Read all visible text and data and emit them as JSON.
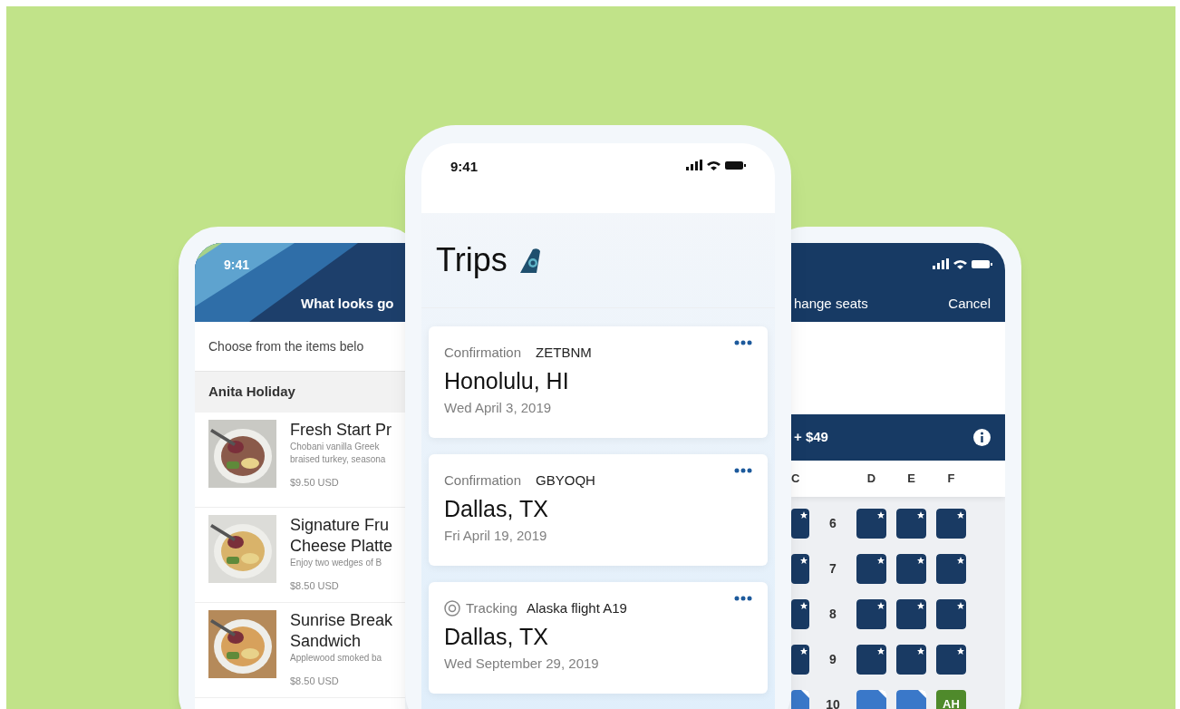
{
  "left_phone": {
    "status_time": "9:41",
    "header_title": "What looks go",
    "intro": "Choose from the items belo",
    "section": "Anita Holiday",
    "items": [
      {
        "title_lines": [
          "Fresh Start Pr"
        ],
        "description_lines": [
          "Chobani vanilla Greek",
          "braised turkey, seasona"
        ],
        "price": "$9.50 USD"
      },
      {
        "title_lines": [
          "Signature Fru",
          "Cheese Platte"
        ],
        "description_lines": [
          "Enjoy two wedges of B"
        ],
        "price": "$8.50 USD"
      },
      {
        "title_lines": [
          "Sunrise Break",
          "Sandwich"
        ],
        "description_lines": [
          "Applewood smoked ba"
        ],
        "price": "$8.50 USD"
      }
    ]
  },
  "center_phone": {
    "status_time": "9:41",
    "title": "Trips",
    "trips": [
      {
        "kind": "confirmation",
        "label": "Confirmation",
        "value": "ZETBNM",
        "city": "Honolulu, HI",
        "date": "Wed April 3, 2019"
      },
      {
        "kind": "confirmation",
        "label": "Confirmation",
        "value": "GBYOQH",
        "city": "Dallas, TX",
        "date": "Fri April 19, 2019"
      },
      {
        "kind": "tracking",
        "label": "Tracking",
        "value": "Alaska flight A19",
        "city": "Dallas, TX",
        "date": "Wed September 29, 2019"
      }
    ]
  },
  "right_phone": {
    "header_title": "hange seats",
    "cancel": "Cancel",
    "fare": "+ $49",
    "columns": [
      "C",
      "D",
      "E",
      "F"
    ],
    "rows": [
      {
        "number": "6",
        "seats": [
          {
            "kind": "premium"
          },
          {
            "kind": "premium"
          },
          {
            "kind": "premium"
          },
          {
            "kind": "premium"
          }
        ]
      },
      {
        "number": "7",
        "seats": [
          {
            "kind": "premium"
          },
          {
            "kind": "premium"
          },
          {
            "kind": "premium"
          },
          {
            "kind": "premium"
          }
        ]
      },
      {
        "number": "8",
        "seats": [
          {
            "kind": "premium"
          },
          {
            "kind": "premium"
          },
          {
            "kind": "premium"
          },
          {
            "kind": "premium"
          }
        ]
      },
      {
        "number": "9",
        "seats": [
          {
            "kind": "premium"
          },
          {
            "kind": "premium"
          },
          {
            "kind": "premium"
          },
          {
            "kind": "premium"
          }
        ]
      },
      {
        "number": "10",
        "seats": [
          {
            "kind": "standard"
          },
          {
            "kind": "standard"
          },
          {
            "kind": "standard"
          },
          {
            "kind": "occupied",
            "label": "AH"
          }
        ]
      }
    ]
  }
}
